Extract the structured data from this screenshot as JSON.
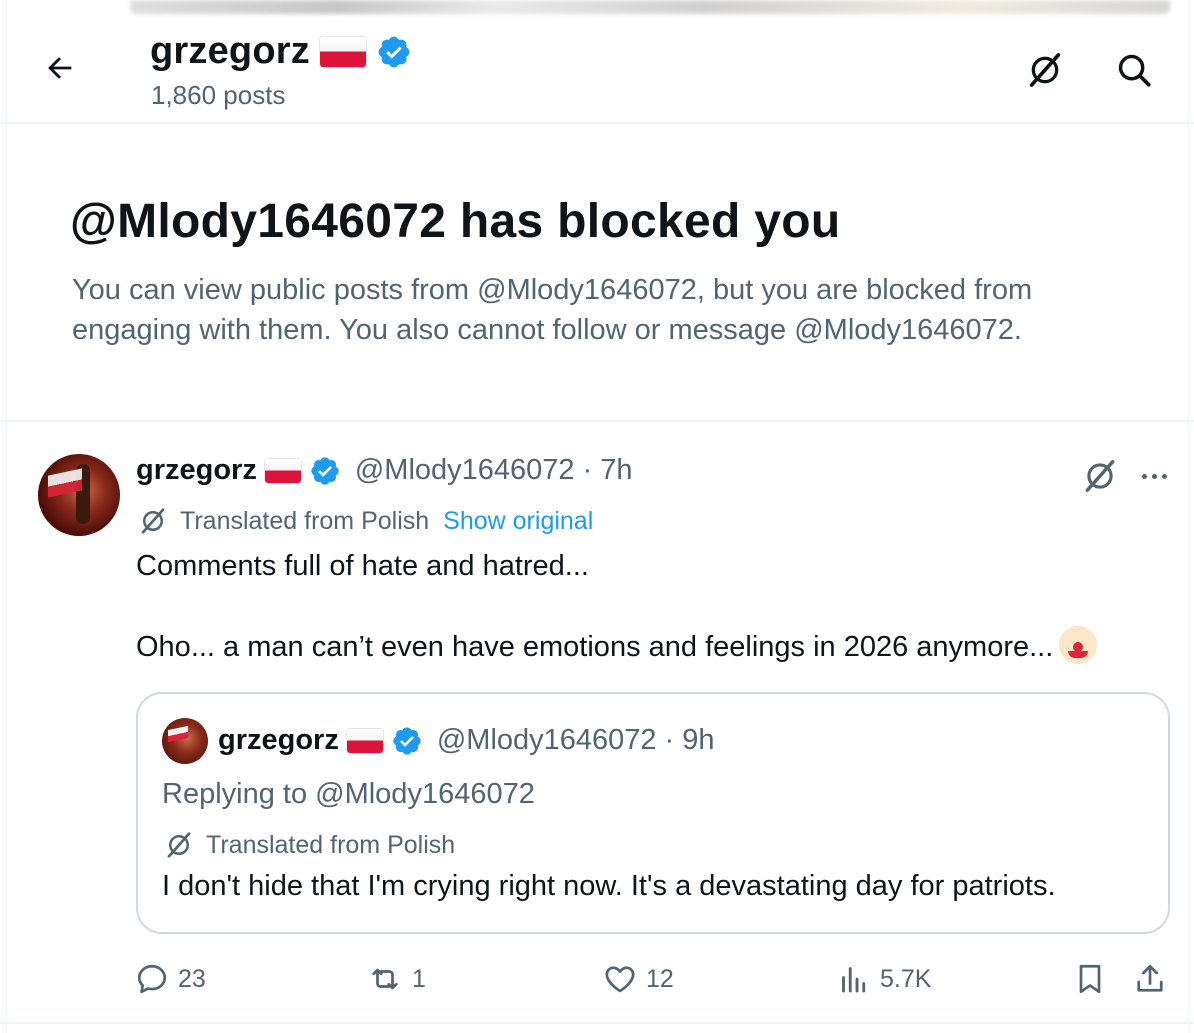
{
  "header": {
    "name": "grzegorz",
    "posts_count": "1,860 posts",
    "icons": [
      "back-arrow-icon",
      "translate-icon",
      "search-icon"
    ]
  },
  "blocked": {
    "title": "@Mlody1646072 has blocked you",
    "description": "You can view public posts from @Mlody1646072, but you are blocked from engaging with them. You also cannot follow or message @Mlody1646072."
  },
  "post": {
    "name": "grzegorz",
    "handle": "@Mlody1646072",
    "separator": "·",
    "time": "7h",
    "translated_label": "Translated from Polish",
    "show_original": "Show original",
    "text_line1": "Comments full of hate and hatred...",
    "text_line2": "Oho... a man can’t even have emotions and feelings in 2026 anymore...",
    "emoji": "clown-face"
  },
  "quote": {
    "name": "grzegorz",
    "handle": "@Mlody1646072",
    "separator": "·",
    "time": "9h",
    "replying_to": "Replying to @Mlody1646072",
    "translated_label": "Translated from Polish",
    "text": "I don't hide that I'm crying right now. It's a devastating day for patriots."
  },
  "actions": {
    "replies": "23",
    "reposts": "1",
    "likes": "12",
    "views": "5.7K"
  },
  "colors": {
    "text_primary": "#0f1419",
    "text_secondary": "#536471",
    "link_blue": "#1d9bf0",
    "verified_blue": "#1d9bf0",
    "border": "#cfd9de",
    "flag_red": "#dc143c"
  }
}
